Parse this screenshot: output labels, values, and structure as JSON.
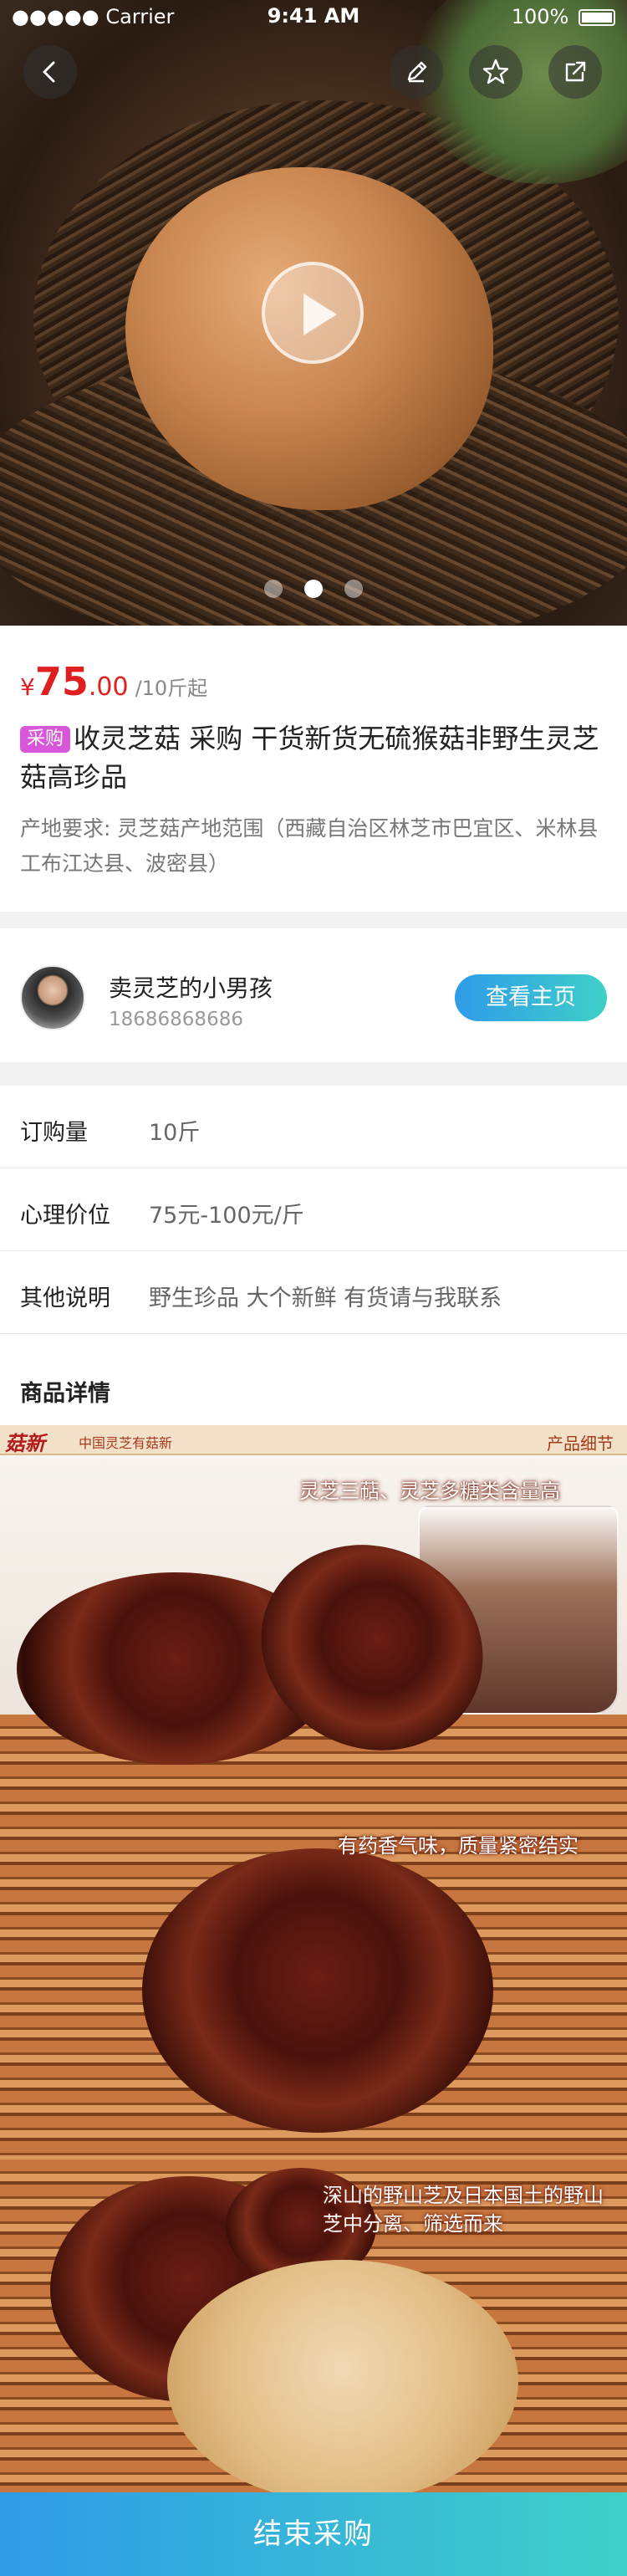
{
  "status_bar": {
    "carrier": "●●●●● Carrier",
    "time": "9:41 AM",
    "battery": "100%"
  },
  "hero": {
    "dots_total": 3,
    "dot_active": 2
  },
  "product": {
    "currency": "¥",
    "price_int": "75",
    "price_dec": ".00",
    "unit": "/10斤起",
    "badge": "采购",
    "title": "收灵芝菇 采购 干货新货无硫猴菇非野生灵芝菇高珍品",
    "origin": "产地要求: 灵芝菇产地范围（西藏自治区林芝市巴宜区、米林县工布江达县、波密县）"
  },
  "seller": {
    "name": "卖灵芝的小男孩",
    "phone": "18686868686",
    "home_button": "查看主页"
  },
  "attributes": [
    {
      "key": "订购量",
      "value": "10斤"
    },
    {
      "key": "心理价位",
      "value": "75元-100元/斤"
    },
    {
      "key": "其他说明",
      "value": "野生珍品 大个新鲜 有货请与我联系"
    }
  ],
  "detail_title": "商品详情",
  "detail_image": {
    "brand": "菇新",
    "brand_slogan": "中国灵芝有菇新",
    "section": "产品细节",
    "caption1": "灵芝三萜、灵芝多糖类含量高",
    "caption2": "有药香气味，质量紧密结实",
    "caption3_line1": "深山的野山芝及日本国土的野山",
    "caption3_line2": "芝中分离、筛选而来"
  },
  "bottom_button": "结束采购",
  "colors": {
    "accent_gradient_start": "#2f9be8",
    "accent_gradient_end": "#3fd0c8",
    "price": "#e02020",
    "badge": "#d857d9"
  }
}
